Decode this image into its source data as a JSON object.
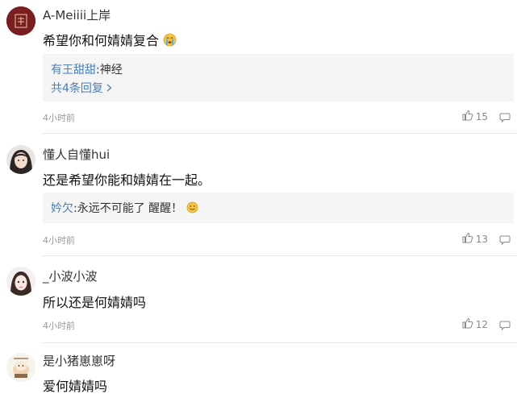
{
  "comments": [
    {
      "username": "A-Meiiii上岸",
      "text": "希望你和何婧婧复合",
      "reply": {
        "user": "有王甜甜",
        "text": ":神经",
        "more": "共4条回复"
      },
      "time": "4小时前",
      "likes": "15"
    },
    {
      "username": "懂人自懂hui",
      "text": "还是希望你能和婧婧在一起。",
      "reply": {
        "user": "妗欠",
        "text": ":永远不可能了 醒醒！"
      },
      "time": "4小时前",
      "likes": "13"
    },
    {
      "username": "_小波小波",
      "text": "所以还是何婧婧吗",
      "time": "4小时前",
      "likes": "12"
    },
    {
      "username": "是小猪崽崽呀",
      "text": "爱何婧婧吗"
    }
  ]
}
